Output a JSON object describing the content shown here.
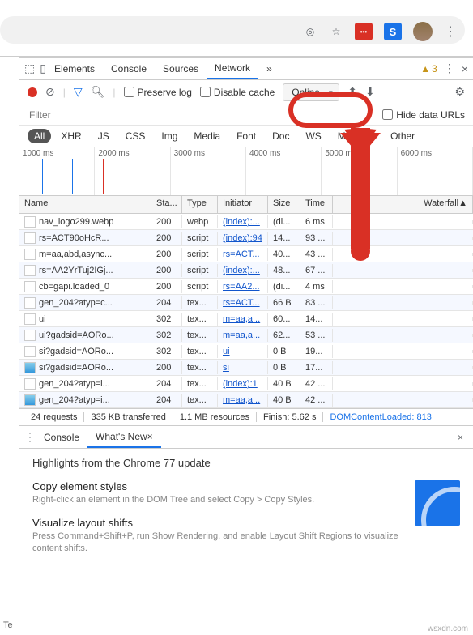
{
  "browser": {
    "ext_blue_label": "S"
  },
  "tabs": {
    "elements": "Elements",
    "console": "Console",
    "sources": "Sources",
    "network": "Network",
    "more": "»",
    "warnings": "3"
  },
  "toolbar": {
    "preserve_log": "Preserve log",
    "disable_cache": "Disable cache",
    "online": "Online"
  },
  "filter": {
    "placeholder": "Filter",
    "hide_urls": "Hide data URLs"
  },
  "chips": [
    "All",
    "XHR",
    "JS",
    "CSS",
    "Img",
    "Media",
    "Font",
    "Doc",
    "WS",
    "Manifest",
    "Other"
  ],
  "timeline": [
    "1000 ms",
    "2000 ms",
    "3000 ms",
    "4000 ms",
    "5000 ms",
    "6000 ms"
  ],
  "columns": {
    "name": "Name",
    "status": "Sta...",
    "type": "Type",
    "initiator": "Initiator",
    "size": "Size",
    "time": "Time",
    "waterfall": "Waterfall"
  },
  "rows": [
    {
      "name": "nav_logo299.webp",
      "status": "200",
      "type": "webp",
      "initiator": "(index):...",
      "size": "(di...",
      "time": "6 ms",
      "wf": {
        "l": 2,
        "w": 2,
        "c": "#9aa0a6"
      }
    },
    {
      "name": "rs=ACT90oHcR...",
      "status": "200",
      "type": "script",
      "initiator": "(index):94",
      "size": "14...",
      "time": "93 ...",
      "wf": {
        "l": 30,
        "w": 6,
        "c": "#34a853"
      }
    },
    {
      "name": "m=aa,abd,async...",
      "status": "200",
      "type": "script",
      "initiator": "rs=ACT...",
      "size": "40...",
      "time": "43 ...",
      "wf": {
        "l": 30,
        "w": 3,
        "c": "#34a853"
      }
    },
    {
      "name": "rs=AA2YrTuj2IGj...",
      "status": "200",
      "type": "script",
      "initiator": "(index):...",
      "size": "48...",
      "time": "67 ...",
      "wf": {
        "l": 30,
        "w": 4,
        "c": "#34a853"
      }
    },
    {
      "name": "cb=gapi.loaded_0",
      "status": "200",
      "type": "script",
      "initiator": "rs=AA2...",
      "size": "(di...",
      "time": "4 ms",
      "wf": {
        "l": 31,
        "w": 2,
        "c": "#9aa0a6"
      }
    },
    {
      "name": "gen_204?atyp=c...",
      "status": "204",
      "type": "tex...",
      "initiator": "rs=ACT...",
      "size": "66 B",
      "time": "83 ...",
      "wf": {
        "l": 42,
        "w": 6,
        "c": "#1fc36a"
      }
    },
    {
      "name": "ui",
      "status": "302",
      "type": "tex...",
      "initiator": "m=aa,a...",
      "size": "60...",
      "time": "14...",
      "wf": {
        "l": 43,
        "w": 2,
        "c": "#1a73e8"
      }
    },
    {
      "name": "ui?gadsid=AORo...",
      "status": "302",
      "type": "tex...",
      "initiator": "m=aa,a...",
      "size": "62...",
      "time": "53 ...",
      "wf": {
        "l": 44,
        "w": 2,
        "c": "#1a73e8"
      }
    },
    {
      "name": "si?gadsid=AORo...",
      "status": "302",
      "type": "tex...",
      "initiator": "ui",
      "size": "0 B",
      "time": "19...",
      "wf": {
        "l": 56,
        "w": 6,
        "c": "#1fc36a"
      }
    },
    {
      "name": "si?gadsid=AORo...",
      "status": "200",
      "type": "tex...",
      "initiator": "si",
      "size": "0 B",
      "time": "17...",
      "wf": {
        "l": 68,
        "w": 6,
        "c": "#1fc36a"
      },
      "img": true
    },
    {
      "name": "gen_204?atyp=i...",
      "status": "204",
      "type": "tex...",
      "initiator": "(index):1",
      "size": "40 B",
      "time": "42 ...",
      "wf": {
        "l": 80,
        "w": 6,
        "c": "#1fc36a"
      }
    },
    {
      "name": "gen_204?atyp=i...",
      "status": "204",
      "type": "tex...",
      "initiator": "m=aa,a...",
      "size": "40 B",
      "time": "42 ...",
      "wf": {
        "l": 80,
        "w": 6,
        "c": "#1fc36a"
      },
      "img": true
    }
  ],
  "status": {
    "requests": "24 requests",
    "transferred": "335 KB transferred",
    "resources": "1.1 MB resources",
    "finish": "Finish: 5.62 s",
    "dcl": "DOMContentLoaded: 813"
  },
  "drawer": {
    "console": "Console",
    "whatsnew": "What's New",
    "x": "×"
  },
  "whatsnew": {
    "title": "Highlights from the Chrome 77 update",
    "h1": "Copy element styles",
    "p1": "Right-click an element in the DOM Tree and select Copy > Copy Styles.",
    "h2": "Visualize layout shifts",
    "p2": "Press Command+Shift+P, run Show Rendering, and enable Layout Shift Regions to visualize content shifts."
  },
  "footer": "Te",
  "watermark": "wsxdn.com"
}
